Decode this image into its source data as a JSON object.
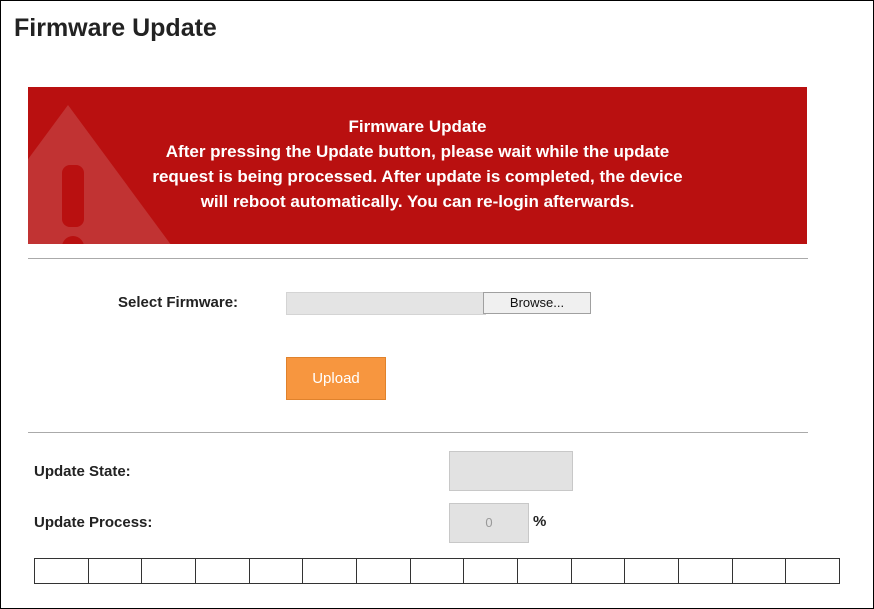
{
  "page": {
    "title": "Firmware Update"
  },
  "banner": {
    "heading": "Firmware Update",
    "lines": [
      "After pressing the Update button, please wait while the update",
      "request is being processed. After update is completed, the device",
      "will reboot automatically. You can re-login afterwards."
    ],
    "icon": "warning-triangle-icon",
    "color": "#b91010"
  },
  "form": {
    "select_label": "Select Firmware:",
    "file_value": "",
    "browse_label": "Browse...",
    "upload_label": "Upload",
    "upload_color": "#f7963f"
  },
  "status": {
    "state_label": "Update State:",
    "state_value": "",
    "process_label": "Update Process:",
    "process_value": "0",
    "percent_sign": "%",
    "progress_fraction": 0,
    "progress_segments": 15
  }
}
